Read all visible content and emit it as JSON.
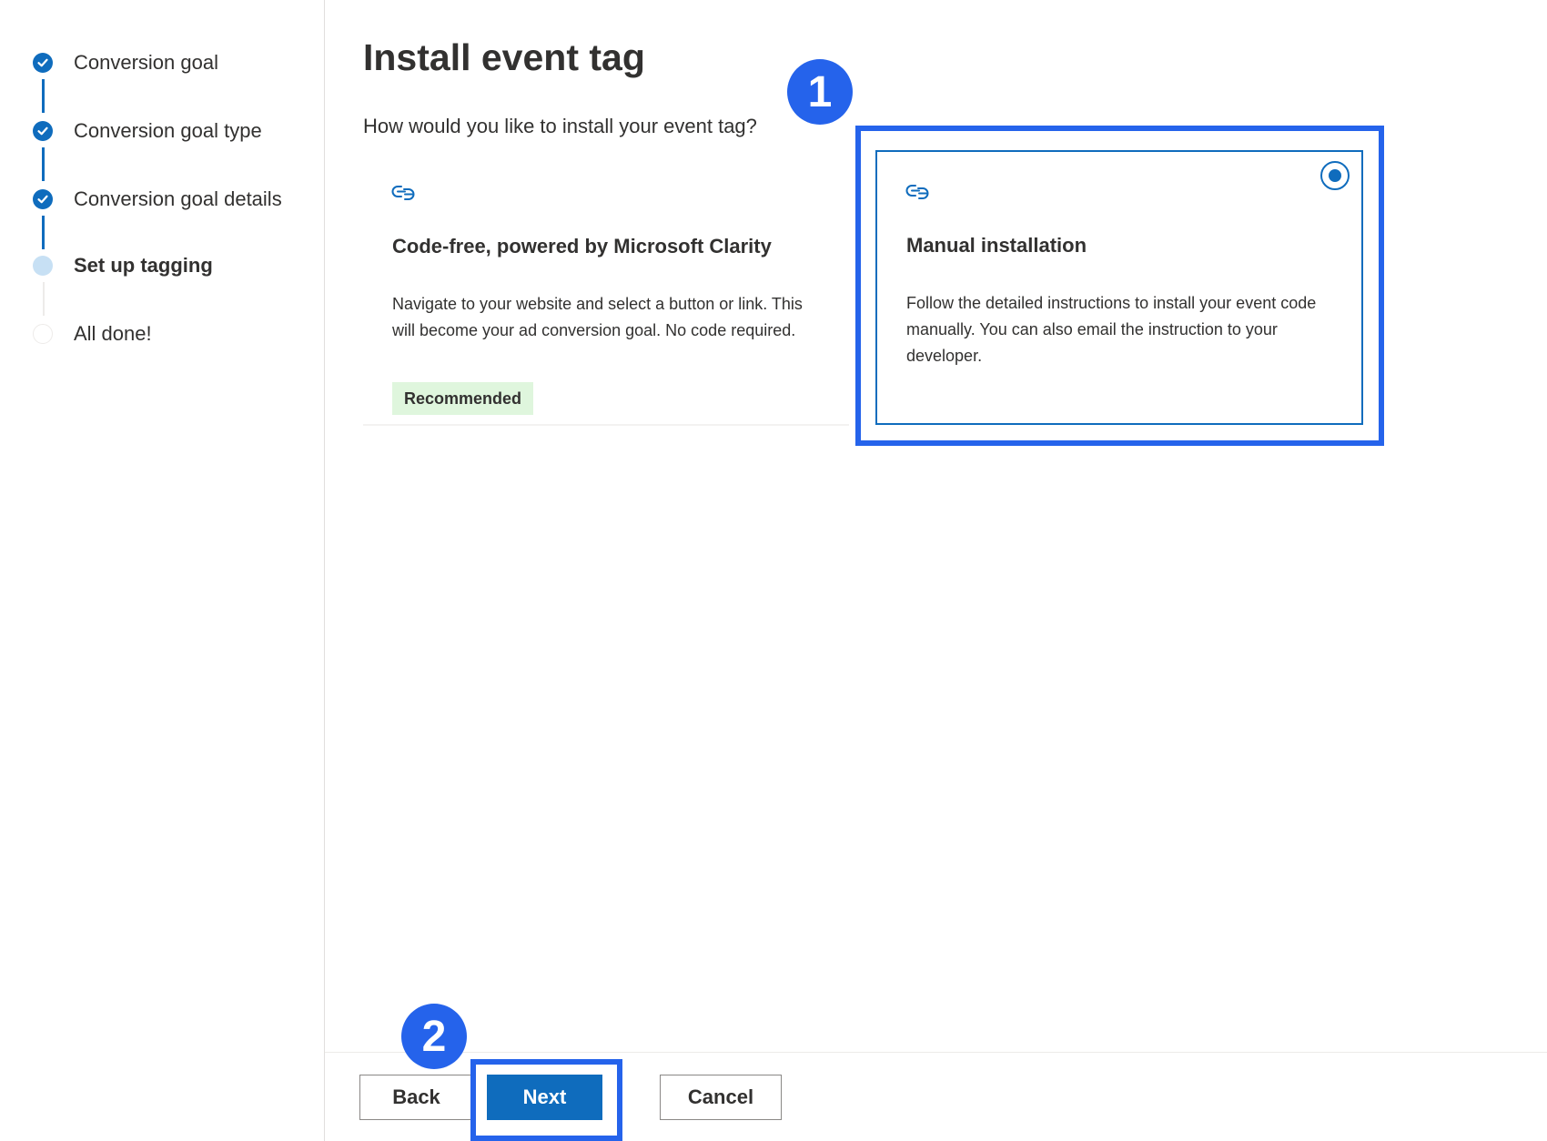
{
  "stepper": {
    "steps": [
      {
        "label": "Conversion goal",
        "status": "done"
      },
      {
        "label": "Conversion goal type",
        "status": "done"
      },
      {
        "label": "Conversion goal details",
        "status": "done"
      },
      {
        "label": "Set up tagging",
        "status": "current"
      },
      {
        "label": "All done!",
        "status": "todo"
      }
    ]
  },
  "main": {
    "title": "Install event tag",
    "question": "How would you like to install your event tag?",
    "options": [
      {
        "icon": "link-icon",
        "title": "Code-free, powered by Microsoft Clarity",
        "description": "Navigate to your website and select a button or link. This will become your ad conversion goal. No code required.",
        "badge": "Recommended",
        "selected": false
      },
      {
        "icon": "link-icon",
        "title": "Manual installation",
        "description": "Follow the detailed instructions to install your event code manually. You can also email the instruction to your developer.",
        "selected": true
      }
    ]
  },
  "annotations": {
    "marker_1": "1",
    "marker_2": "2",
    "highlight_color": "#2563eb"
  },
  "footer": {
    "back_label": "Back",
    "next_label": "Next",
    "cancel_label": "Cancel"
  },
  "colors": {
    "accent": "#0f6cbd",
    "badge_bg": "#dff6dd"
  }
}
